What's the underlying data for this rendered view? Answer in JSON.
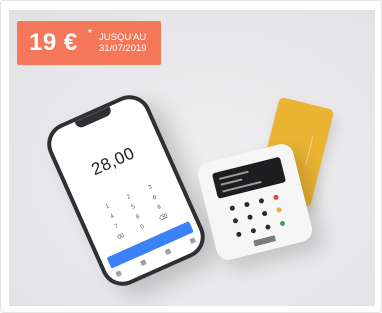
{
  "badge": {
    "price": "19 €",
    "asterisk": "*",
    "until": "JUSQU'AU",
    "date": "31/07/2019",
    "color": "#f4775a"
  },
  "phone": {
    "amount": "28,00",
    "keys": [
      "1",
      "2",
      "3",
      "4",
      "5",
      "6",
      "7",
      "8",
      "9",
      "00",
      "0",
      "⌫"
    ]
  }
}
